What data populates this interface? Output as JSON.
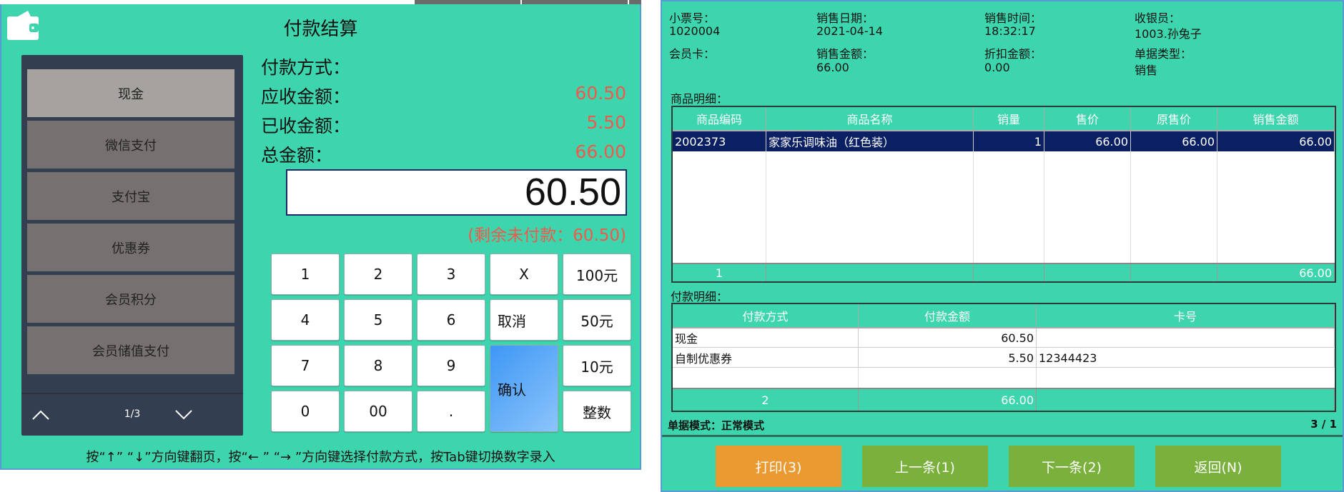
{
  "payment": {
    "title": "付款结算",
    "icon": "wallet-icon",
    "methods": [
      "现金",
      "微信支付",
      "支付宝",
      "优惠券",
      "会员积分",
      "会员储值支付"
    ],
    "selected_method": "现金",
    "page": "1/3",
    "labels": {
      "method": "付款方式：",
      "receivable": "应收金额：",
      "received": "已收金额：",
      "total": "总金额："
    },
    "values": {
      "method": "",
      "receivable": "60.50",
      "received": "5.50",
      "total": "66.00"
    },
    "input_value": "60.50",
    "remaining": "(剩余未付款：60.50)",
    "keys": [
      "1",
      "2",
      "3",
      "X",
      "100元",
      "4",
      "5",
      "6",
      "取消",
      "50元",
      "7",
      "8",
      "9",
      "确认",
      "10元",
      "0",
      "00",
      ".",
      "整数"
    ],
    "hint": "按“↑” “↓”方向键翻页，按“← ” “→ ”方向键选择付款方式，按Tab键切换数字录入",
    "colors": {
      "bg": "#3dd5ad",
      "amount": "#ef5a4c",
      "sidebar": "#333e51"
    }
  },
  "receipt": {
    "fields": [
      {
        "label": "小票号：",
        "value": "1020004"
      },
      {
        "label": "销售日期：",
        "value": "2021-04-14"
      },
      {
        "label": "销售时间：",
        "value": "18:32:17"
      },
      {
        "label": "收银员：",
        "value": "1003.孙兔子"
      },
      {
        "label": "会员卡：",
        "value": ""
      },
      {
        "label": "销售金额：",
        "value": "66.00"
      },
      {
        "label": "折扣金额：",
        "value": "0.00"
      },
      {
        "label": "单据类型：",
        "value": "销售"
      }
    ],
    "goods_title": "商品明细：",
    "goods_headers": [
      "商品编码",
      "商品名称",
      "销量",
      "售价",
      "原售价",
      "销售金额"
    ],
    "goods_rows": [
      [
        "2002373",
        "家家乐调味油（红色装）",
        "1",
        "66.00",
        "66.00",
        "66.00"
      ]
    ],
    "goods_footer": [
      "1",
      "",
      "",
      "",
      "",
      "66.00"
    ],
    "pay_title": "付款明细：",
    "pay_headers": [
      "付款方式",
      "付款金额",
      "卡号"
    ],
    "pay_rows": [
      [
        "现金",
        "60.50",
        ""
      ],
      [
        "自制优惠券",
        "5.50",
        "12344423"
      ]
    ],
    "pay_footer": [
      "2",
      "66.00",
      ""
    ],
    "mode": "单据模式：正常模式",
    "page": "3 / 1",
    "buttons": [
      {
        "label": "打印(3)",
        "color": "#ea9a30"
      },
      {
        "label": "上一条(1)",
        "color": "#7ab03c"
      },
      {
        "label": "下一条(2)",
        "color": "#7ab03c"
      },
      {
        "label": "返回(N)",
        "color": "#7ab03c"
      }
    ],
    "selected_row_color": "#0b1f63"
  }
}
